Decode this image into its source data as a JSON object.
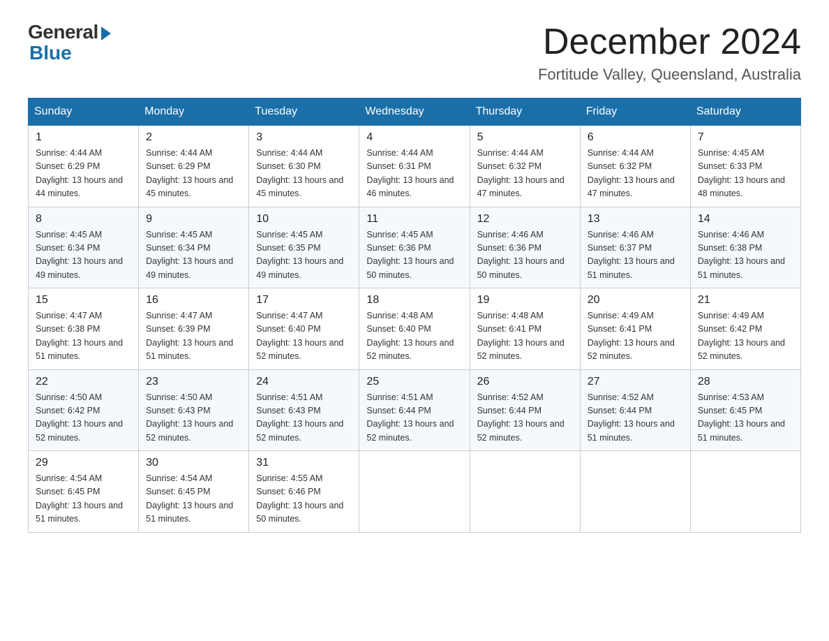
{
  "header": {
    "logo_general": "General",
    "logo_blue": "Blue",
    "month_title": "December 2024",
    "location": "Fortitude Valley, Queensland, Australia"
  },
  "columns": [
    "Sunday",
    "Monday",
    "Tuesday",
    "Wednesday",
    "Thursday",
    "Friday",
    "Saturday"
  ],
  "weeks": [
    [
      {
        "day": "1",
        "sunrise": "4:44 AM",
        "sunset": "6:29 PM",
        "daylight": "13 hours and 44 minutes."
      },
      {
        "day": "2",
        "sunrise": "4:44 AM",
        "sunset": "6:29 PM",
        "daylight": "13 hours and 45 minutes."
      },
      {
        "day": "3",
        "sunrise": "4:44 AM",
        "sunset": "6:30 PM",
        "daylight": "13 hours and 45 minutes."
      },
      {
        "day": "4",
        "sunrise": "4:44 AM",
        "sunset": "6:31 PM",
        "daylight": "13 hours and 46 minutes."
      },
      {
        "day": "5",
        "sunrise": "4:44 AM",
        "sunset": "6:32 PM",
        "daylight": "13 hours and 47 minutes."
      },
      {
        "day": "6",
        "sunrise": "4:44 AM",
        "sunset": "6:32 PM",
        "daylight": "13 hours and 47 minutes."
      },
      {
        "day": "7",
        "sunrise": "4:45 AM",
        "sunset": "6:33 PM",
        "daylight": "13 hours and 48 minutes."
      }
    ],
    [
      {
        "day": "8",
        "sunrise": "4:45 AM",
        "sunset": "6:34 PM",
        "daylight": "13 hours and 49 minutes."
      },
      {
        "day": "9",
        "sunrise": "4:45 AM",
        "sunset": "6:34 PM",
        "daylight": "13 hours and 49 minutes."
      },
      {
        "day": "10",
        "sunrise": "4:45 AM",
        "sunset": "6:35 PM",
        "daylight": "13 hours and 49 minutes."
      },
      {
        "day": "11",
        "sunrise": "4:45 AM",
        "sunset": "6:36 PM",
        "daylight": "13 hours and 50 minutes."
      },
      {
        "day": "12",
        "sunrise": "4:46 AM",
        "sunset": "6:36 PM",
        "daylight": "13 hours and 50 minutes."
      },
      {
        "day": "13",
        "sunrise": "4:46 AM",
        "sunset": "6:37 PM",
        "daylight": "13 hours and 51 minutes."
      },
      {
        "day": "14",
        "sunrise": "4:46 AM",
        "sunset": "6:38 PM",
        "daylight": "13 hours and 51 minutes."
      }
    ],
    [
      {
        "day": "15",
        "sunrise": "4:47 AM",
        "sunset": "6:38 PM",
        "daylight": "13 hours and 51 minutes."
      },
      {
        "day": "16",
        "sunrise": "4:47 AM",
        "sunset": "6:39 PM",
        "daylight": "13 hours and 51 minutes."
      },
      {
        "day": "17",
        "sunrise": "4:47 AM",
        "sunset": "6:40 PM",
        "daylight": "13 hours and 52 minutes."
      },
      {
        "day": "18",
        "sunrise": "4:48 AM",
        "sunset": "6:40 PM",
        "daylight": "13 hours and 52 minutes."
      },
      {
        "day": "19",
        "sunrise": "4:48 AM",
        "sunset": "6:41 PM",
        "daylight": "13 hours and 52 minutes."
      },
      {
        "day": "20",
        "sunrise": "4:49 AM",
        "sunset": "6:41 PM",
        "daylight": "13 hours and 52 minutes."
      },
      {
        "day": "21",
        "sunrise": "4:49 AM",
        "sunset": "6:42 PM",
        "daylight": "13 hours and 52 minutes."
      }
    ],
    [
      {
        "day": "22",
        "sunrise": "4:50 AM",
        "sunset": "6:42 PM",
        "daylight": "13 hours and 52 minutes."
      },
      {
        "day": "23",
        "sunrise": "4:50 AM",
        "sunset": "6:43 PM",
        "daylight": "13 hours and 52 minutes."
      },
      {
        "day": "24",
        "sunrise": "4:51 AM",
        "sunset": "6:43 PM",
        "daylight": "13 hours and 52 minutes."
      },
      {
        "day": "25",
        "sunrise": "4:51 AM",
        "sunset": "6:44 PM",
        "daylight": "13 hours and 52 minutes."
      },
      {
        "day": "26",
        "sunrise": "4:52 AM",
        "sunset": "6:44 PM",
        "daylight": "13 hours and 52 minutes."
      },
      {
        "day": "27",
        "sunrise": "4:52 AM",
        "sunset": "6:44 PM",
        "daylight": "13 hours and 51 minutes."
      },
      {
        "day": "28",
        "sunrise": "4:53 AM",
        "sunset": "6:45 PM",
        "daylight": "13 hours and 51 minutes."
      }
    ],
    [
      {
        "day": "29",
        "sunrise": "4:54 AM",
        "sunset": "6:45 PM",
        "daylight": "13 hours and 51 minutes."
      },
      {
        "day": "30",
        "sunrise": "4:54 AM",
        "sunset": "6:45 PM",
        "daylight": "13 hours and 51 minutes."
      },
      {
        "day": "31",
        "sunrise": "4:55 AM",
        "sunset": "6:46 PM",
        "daylight": "13 hours and 50 minutes."
      },
      null,
      null,
      null,
      null
    ]
  ]
}
